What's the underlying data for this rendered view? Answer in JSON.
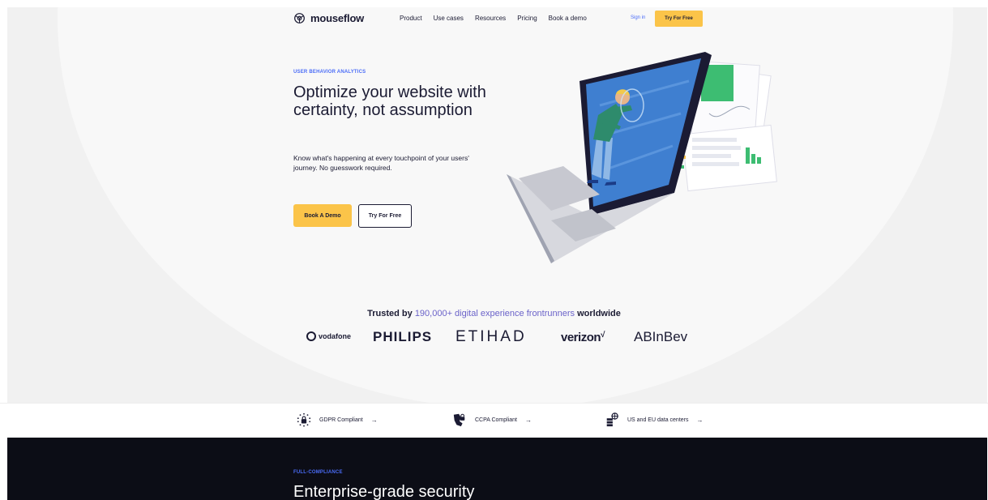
{
  "nav": {
    "brand": "mouseflow",
    "links": [
      "Product",
      "Use cases",
      "Resources",
      "Pricing",
      "Book a demo"
    ],
    "sign_in": "Sign in",
    "cta": "Try For Free"
  },
  "hero": {
    "eyebrow": "USER BEHAVIOR ANALYTICS",
    "headline": "Optimize your website with certainty, not assumption",
    "lead": "Know what's happening at every touchpoint of your users' journey. No guesswork required.",
    "primary_button": "Book A Demo",
    "secondary_button": "Try For Free"
  },
  "trusted": {
    "prefix": "Trusted by",
    "highlight": "190,000+ digital experience frontrunners",
    "suffix": "worldwide",
    "logos": [
      "vodafone",
      "PHILIPS",
      "ETIHAD",
      "verizon",
      "ABInBev"
    ]
  },
  "compliance": [
    {
      "label": "GDPR Compliant",
      "icon": "gdpr-lock-icon"
    },
    {
      "label": "CCPA Compliant",
      "icon": "ccpa-lock-icon"
    },
    {
      "label": "US and EU data centers",
      "icon": "data-center-icon"
    }
  ],
  "security": {
    "eyebrow": "FULL-COMPLIANCE",
    "title": "Enterprise-grade security"
  },
  "colors": {
    "accent_yellow": "#fbc449",
    "accent_blue": "#4a6cf7",
    "highlight_purple": "#6b63c9",
    "dark_bg": "#0c0d16",
    "chart_green": "#3dbd72"
  }
}
